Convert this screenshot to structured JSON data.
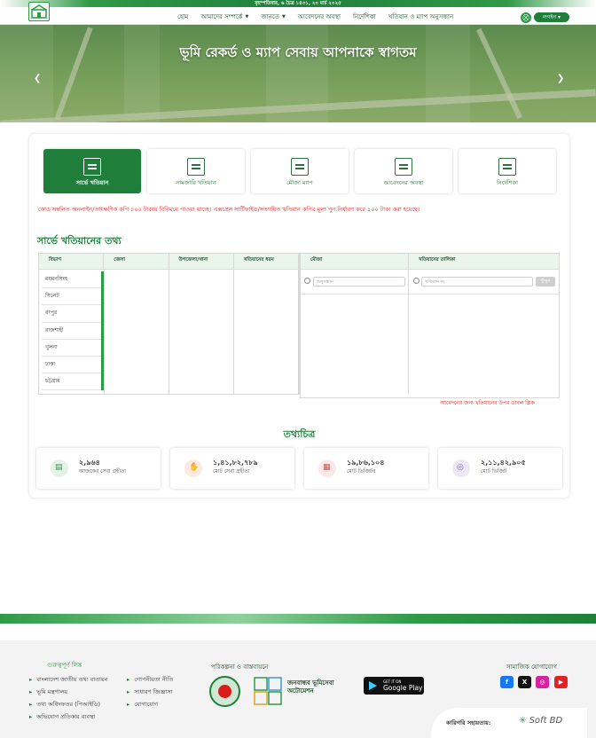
{
  "topbar": {
    "date": "বৃহস্পতিবার, ৬ চৈত্র ১৪৩১, ২০ মার্চ ২০২৫"
  },
  "nav": {
    "items": [
      {
        "label": "হোম",
        "dropdown": false
      },
      {
        "label": "আমাদের সম্পর্কে",
        "dropdown": true
      },
      {
        "label": "জানতে",
        "dropdown": true
      },
      {
        "label": "আবেদনের অবস্থা",
        "dropdown": false
      },
      {
        "label": "নির্দেশিকা",
        "dropdown": false
      },
      {
        "label": "খতিয়ান ও ম্যাপ অনুসন্ধান",
        "dropdown": false
      }
    ],
    "login_label": "লগইন"
  },
  "hero": {
    "title": "ভূমি রেকর্ড ও ম্যাপ সেবায় আপনাকে স্বাগতম",
    "slides": 4,
    "active_slide": 1
  },
  "tabs": [
    {
      "label": "সার্ভে খতিয়ান",
      "active": true,
      "icon": "document-check-icon"
    },
    {
      "label": "নামজারি খতিয়ান",
      "active": false,
      "icon": "document-icon"
    },
    {
      "label": "মৌজা ম্যাপ",
      "active": false,
      "icon": "map-search-icon"
    },
    {
      "label": "আবেদনের অবস্থা",
      "active": false,
      "icon": "application-status-icon"
    },
    {
      "label": "নির্দেশিকা",
      "active": false,
      "icon": "guide-icon"
    }
  ],
  "notice": "কোড সম্বলিত অনলাইন/তাৎক্ষণিক কপি ১০০ টাকায় বিনিময়ে পাওয়া যাচ্ছে। এক্সপ্রেস সার্টিফাইড/সত্যায়িত খতিয়ান কপির মূল্য পুন:নির্ধারণ করে ১০০ টাকা করা হয়েছে।",
  "survey": {
    "title": "সার্ভে খতিয়ানের তথ্য",
    "columns": [
      "বিভাগ",
      "জেলা",
      "উপজেলা/থানা",
      "খতিয়ানের ধরন"
    ],
    "divisions": [
      "ময়মনসিংহ",
      "সিলেট",
      "রংপুর",
      "রাজশাহী",
      "খুলনা",
      "ঢাকা",
      "চট্টগ্রাম"
    ],
    "mouza_header": "মৌজা",
    "khatian_list_header": "খতিয়ানের তালিকা",
    "mouza_search_placeholder": "অনুসন্ধান",
    "khatian_search_placeholder": "খতিয়ান নং",
    "search_button": "খুঁজুন",
    "apply_note": "আবেদনের জন্য খতিয়ানের উপর ডাবল ক্লিক"
  },
  "stats": {
    "title": "তথ্যচিত্র",
    "items": [
      {
        "value": "২,৯৬৪",
        "label": "আজকের সেবা গ্রহীতা",
        "color": "#2e9a47",
        "bg": "#e3f3e6",
        "icon": "user-service-icon"
      },
      {
        "value": "১,৪১,৮২,৭৮৯",
        "label": "মোট সেবা গ্রহীতা",
        "color": "#e2643b",
        "bg": "#fde9e2",
        "icon": "handshake-icon"
      },
      {
        "value": "১৯,৮৬,১০৪",
        "label": "মোট ভিজিটর",
        "color": "#d84b4b",
        "bg": "#fde7e7",
        "icon": "file-icon"
      },
      {
        "value": "২,১১,৪২,৯০৫",
        "label": "মোট ভিজিট",
        "color": "#7b5cc4",
        "bg": "#ede8f8",
        "icon": "visit-icon"
      }
    ]
  },
  "footer": {
    "important_links_title": "গুরুত্বপূর্ণ লিঙ্ক",
    "links_col1": [
      "বাংলাদেশ জাতীয় তথ্য বাতায়ন",
      "ভূমি মন্ত্রণালয়",
      "তথ্য অধিদফতর (পিআইডি)",
      "অভিযোগ প্রতিকার ব্যবস্থা"
    ],
    "links_col2": [
      "গোপনীয়তা নীতি",
      "সাধারণ জিজ্ঞাসা",
      "যোগাযোগ"
    ],
    "plan_title": "পরিকল্পনা ও বাস্তবায়নে",
    "a2i_label": "জনবান্ধব ভূমিসেবা অটোমেশন",
    "google_play_small": "GET IT ON",
    "google_play": "Google Play",
    "social_title": "সামাজিক যোগাযোগ",
    "tech_label": "কারিগরি সহায়তায়:",
    "tech_company": "Soft BD"
  }
}
